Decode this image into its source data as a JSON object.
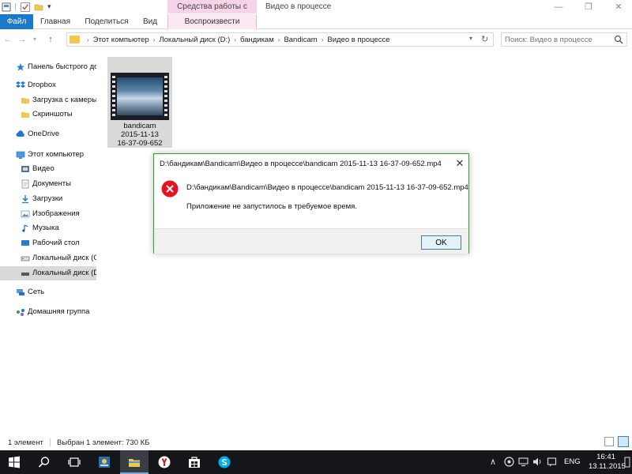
{
  "window": {
    "title": "Видео в процессе",
    "context_tab_header": "Средства работы с видео",
    "minimize_glyph": "—",
    "maximize_glyph": "❐",
    "close_glyph": "✕",
    "quick_access_dropdown": "▾"
  },
  "ribbon": {
    "tabs": [
      "Файл",
      "Главная",
      "Поделиться",
      "Вид",
      "Воспроизвести"
    ],
    "active_tab": "Файл",
    "accent": "#1979ca",
    "context_color": "#f6d3e7"
  },
  "navigation": {
    "back": "←",
    "forward": "→",
    "recent": "▾",
    "up": "↑",
    "breadcrumb": [
      "Этот компьютер",
      "Локальный диск (D:)",
      "бандикам",
      "Bandicam",
      "Видео в процессе"
    ],
    "separator": "›",
    "address_dropdown": "▾",
    "refresh": "↻",
    "search_placeholder": "Поиск: Видео в процессе"
  },
  "sidebar": {
    "items": [
      {
        "label": "Панель быстрого доступа",
        "icon": "star-icon"
      },
      {
        "label": "Dropbox",
        "icon": "dropbox-icon"
      },
      {
        "label": "Загрузка с камеры",
        "icon": "folder-icon"
      },
      {
        "label": "Скриншоты",
        "icon": "folder-icon"
      },
      {
        "label": "OneDrive",
        "icon": "cloud-icon"
      },
      {
        "label": "Этот компьютер",
        "icon": "computer-icon"
      },
      {
        "label": "Видео",
        "icon": "video-folder-icon"
      },
      {
        "label": "Документы",
        "icon": "documents-folder-icon"
      },
      {
        "label": "Загрузки",
        "icon": "downloads-icon"
      },
      {
        "label": "Изображения",
        "icon": "pictures-folder-icon"
      },
      {
        "label": "Музыка",
        "icon": "music-icon"
      },
      {
        "label": "Рабочий стол",
        "icon": "desktop-folder-icon"
      },
      {
        "label": "Локальный диск (C:)",
        "icon": "drive-icon"
      },
      {
        "label": "Локальный диск (D:)",
        "icon": "drive-icon"
      },
      {
        "label": "Сеть",
        "icon": "network-icon"
      },
      {
        "label": "Домашняя группа",
        "icon": "homegroup-icon"
      }
    ],
    "selected": "Локальный диск (D:)"
  },
  "files": [
    {
      "name_lines": [
        "bandicam",
        "2015-11-13",
        "16-37-09-652"
      ],
      "type": "video",
      "selected": true
    }
  ],
  "dialog": {
    "title": "D:\\бандикам\\Bandicam\\Видео в процессе\\bandicam 2015-11-13 16-37-09-652.mp4",
    "path": "D:\\бандикам\\Bandicam\\Видео в процессе\\bandicam 2015-11-13 16-37-09-652.mp4",
    "message": "Приложение не запустилось в требуемое время.",
    "ok_label": "OK",
    "close_glyph": "✕",
    "border_color": "#2eaa2e",
    "error_color": "#e81123"
  },
  "status": {
    "count": "1 элемент",
    "selection": "Выбран 1 элемент: 730 КБ"
  },
  "taskbar": {
    "apps": [
      "windows-start-icon",
      "search-icon",
      "task-view-icon",
      "app-icon",
      "file-explorer-icon",
      "yandex-browser-icon",
      "store-icon",
      "skype-icon"
    ],
    "active_app": "file-explorer-icon",
    "tray_chevron": "∧",
    "language": "ENG",
    "time": "16:41",
    "date": "13.11.2015"
  }
}
